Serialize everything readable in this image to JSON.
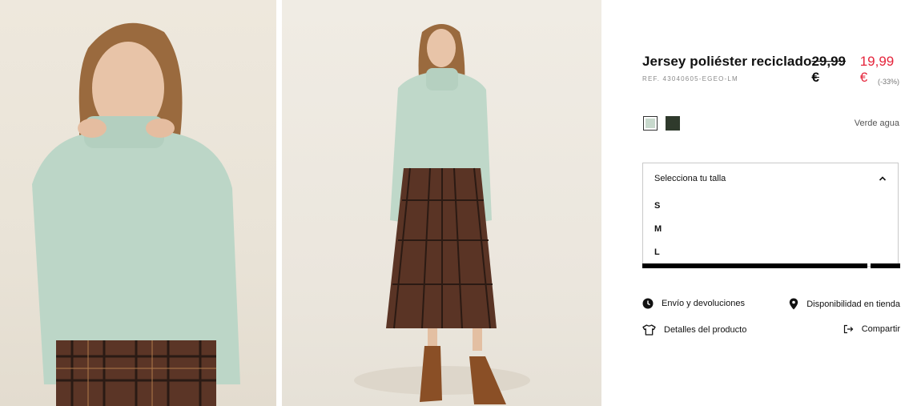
{
  "product": {
    "title": "Jersey poliéster reciclado",
    "old_price": "29,99 €",
    "new_price": "19,99 €",
    "reference": "REF. 43040605-EGEO-LM",
    "discount": "(-33%)"
  },
  "colors": {
    "selected_name": "Verde agua",
    "options": [
      {
        "name": "verde-agua",
        "hex": "#c8d9cd"
      },
      {
        "name": "dark-green",
        "hex": "#2f3a2c"
      }
    ]
  },
  "sizes": {
    "label": "Selecciona tu talla",
    "options": [
      "S",
      "M",
      "L"
    ]
  },
  "links": {
    "shipping": "Envío y devoluciones",
    "store": "Disponibilidad en tienda",
    "details": "Detalles del producto",
    "share": "Compartir"
  },
  "accent": "#e5243b"
}
